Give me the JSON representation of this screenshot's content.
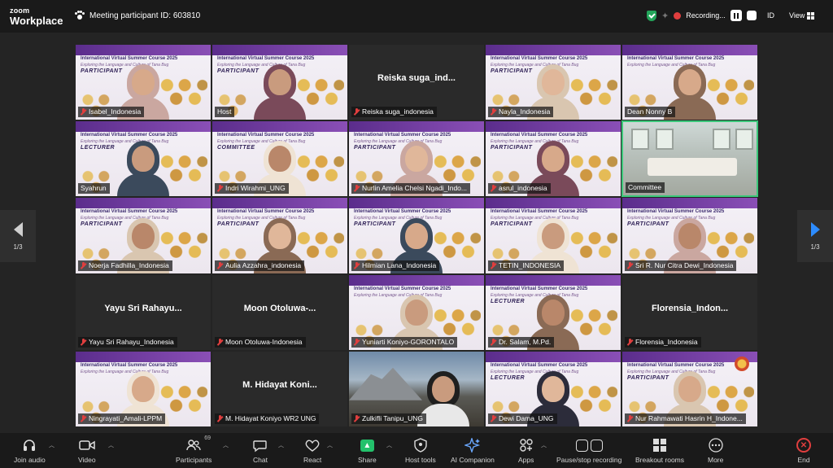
{
  "app": {
    "brand_line1": "zoom",
    "brand_line2": "Workplace"
  },
  "meeting": {
    "id_label": "Meeting participant ID: 603810"
  },
  "recording": {
    "label": "Recording..."
  },
  "header_right": {
    "id_label": "ID",
    "view_label": "View"
  },
  "pagination": {
    "left": "1/3",
    "right": "1/3"
  },
  "slide": {
    "title": "International Virtual Summer Course 2025",
    "subtitle": "Exploring the Language and Culture of Tana Bug",
    "roles": {
      "participant": "PARTICIPANT",
      "committee": "COMMITTEE",
      "lecturer": "LECTURER"
    }
  },
  "tiles": [
    {
      "name": "Isabel_Indonesia",
      "kind": "slide",
      "role": "PARTICIPANT",
      "muted": true
    },
    {
      "name": "Host",
      "kind": "slide",
      "role": "PARTICIPANT",
      "muted": false
    },
    {
      "name": "Reiska suga_indonesia",
      "kind": "dark",
      "big": "Reiska  suga_ind...",
      "muted": true
    },
    {
      "name": "Nayla_Indonesia",
      "kind": "slide",
      "role": "PARTICIPANT",
      "muted": true
    },
    {
      "name": "Dean Nonny B",
      "kind": "slide",
      "role": "",
      "muted": false
    },
    {
      "name": "Syahrun",
      "kind": "slide",
      "role": "LECTURER",
      "muted": false
    },
    {
      "name": "Indri Wirahmi_UNG",
      "kind": "slide",
      "role": "COMMITTEE",
      "muted": true
    },
    {
      "name": "Nurlin Amelia Chelsi Ngadi_Indo...",
      "kind": "slide",
      "role": "PARTICIPANT",
      "muted": true
    },
    {
      "name": "asrul_indonesia",
      "kind": "slide",
      "role": "PARTICIPANT",
      "muted": true
    },
    {
      "name": "Committee",
      "kind": "classroom",
      "muted": false
    },
    {
      "name": "Noerja Fadhilla_Indonesia",
      "kind": "slide",
      "role": "PARTICIPANT",
      "muted": true
    },
    {
      "name": "Aulia Azzahra_indonesia",
      "kind": "slide",
      "role": "PARTICIPANT",
      "muted": true
    },
    {
      "name": "Hilmian Lana_Indonesia",
      "kind": "slide",
      "role": "PARTICIPANT",
      "muted": true
    },
    {
      "name": "TETIN_INDONESIA",
      "kind": "slide",
      "role": "PARTICIPANT",
      "muted": true
    },
    {
      "name": "Sri R. Nur Citra Dewi_Indonesia",
      "kind": "slide",
      "role": "PARTICIPANT",
      "muted": true
    },
    {
      "name": "Yayu Sri Rahayu_Indonesia",
      "kind": "dark",
      "big": "Yayu Sri Rahayu...",
      "muted": true
    },
    {
      "name": "Moon Otoluwa-Indonesia",
      "kind": "dark",
      "big": "Moon  Otoluwa-...",
      "muted": true
    },
    {
      "name": "Yuniarti Koniyo-GORONTALO",
      "kind": "slide",
      "role": "",
      "muted": true
    },
    {
      "name": "Dr. Salam, M.Pd.",
      "kind": "slide",
      "role": "LECTURER",
      "muted": true
    },
    {
      "name": "Florensia_Indonesia",
      "kind": "dark",
      "big": "Florensia_Indon...",
      "muted": true
    },
    {
      "name": "Ningrayati_Amali-LPPM",
      "kind": "slide",
      "role": "",
      "muted": true
    },
    {
      "name": "M. Hidayat Koniyo WR2 UNG",
      "kind": "dark",
      "big": "M.  Hidayat  Koni...",
      "muted": true
    },
    {
      "name": "Zulkifli Tanipu_UNG",
      "kind": "mountain",
      "muted": true
    },
    {
      "name": "Dewi Dama_UNG",
      "kind": "slide",
      "role": "LECTURER",
      "muted": true
    },
    {
      "name": "Nur Rahmawati Hasrin H_Indone...",
      "kind": "slide",
      "role": "PARTICIPANT",
      "muted": true
    }
  ],
  "toolbar": {
    "join_audio": "Join audio",
    "video": "Video",
    "participants": "Participants",
    "participants_count": "69",
    "chat": "Chat",
    "react": "React",
    "share": "Share",
    "host_tools": "Host tools",
    "ai_companion": "AI Companion",
    "apps": "Apps",
    "pause_stop": "Pause/stop recording",
    "breakout": "Breakout rooms",
    "more": "More",
    "end": "End"
  },
  "colors": {
    "accent": "#2d8cff",
    "record": "#e03e3e",
    "active_speaker": "#3cc77a",
    "share": "#23c16b"
  }
}
